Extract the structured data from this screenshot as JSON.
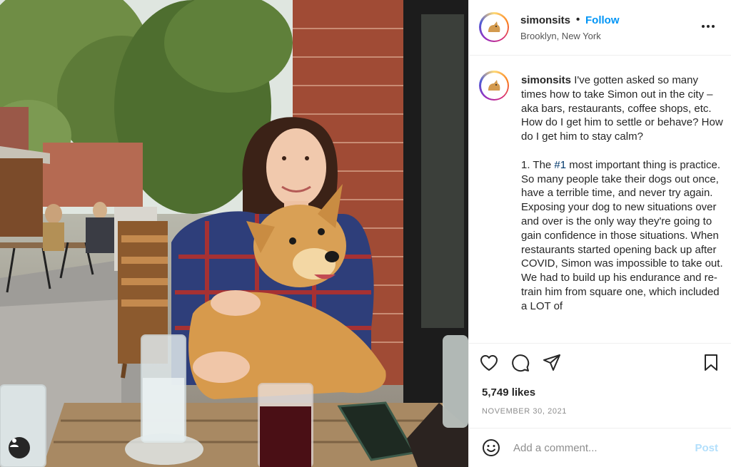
{
  "post": {
    "username": "simonsits",
    "follow_label": "Follow",
    "separator": "•",
    "location": "Brooklyn, New York",
    "caption_username": "simonsits",
    "caption_part1": " I've gotten asked so many times how to take Simon out in the city – aka bars, restaurants, coffee shops, etc. How do I get him to settle or behave? How do I get him to stay calm?\n\n1. The ",
    "caption_hashtag": "#1",
    "caption_part2": " most important thing is practice. So many people take their dogs out once, have a terrible time, and never try again. Exposing your dog to new situations over and over is the only way they're going to gain confidence in those situations. When restaurants started opening back up after COVID, Simon was impossible to take out. We had to build up his endurance and re-train him from square one, which included a LOT of",
    "likes": "5,749 likes",
    "date": "NOVEMBER 30, 2021"
  },
  "icons": {
    "more": "more-options-icon",
    "like": "heart-icon",
    "comment": "comment-bubble-icon",
    "share": "paper-plane-icon",
    "save": "bookmark-icon",
    "emoji": "smiley-icon",
    "user_tag": "user-tag-icon"
  },
  "comment_box": {
    "placeholder": "Add a comment...",
    "post_label": "Post"
  },
  "colors": {
    "accent": "#0095f6",
    "post_disabled": "#b2dffc",
    "hashtag": "#00376b"
  }
}
